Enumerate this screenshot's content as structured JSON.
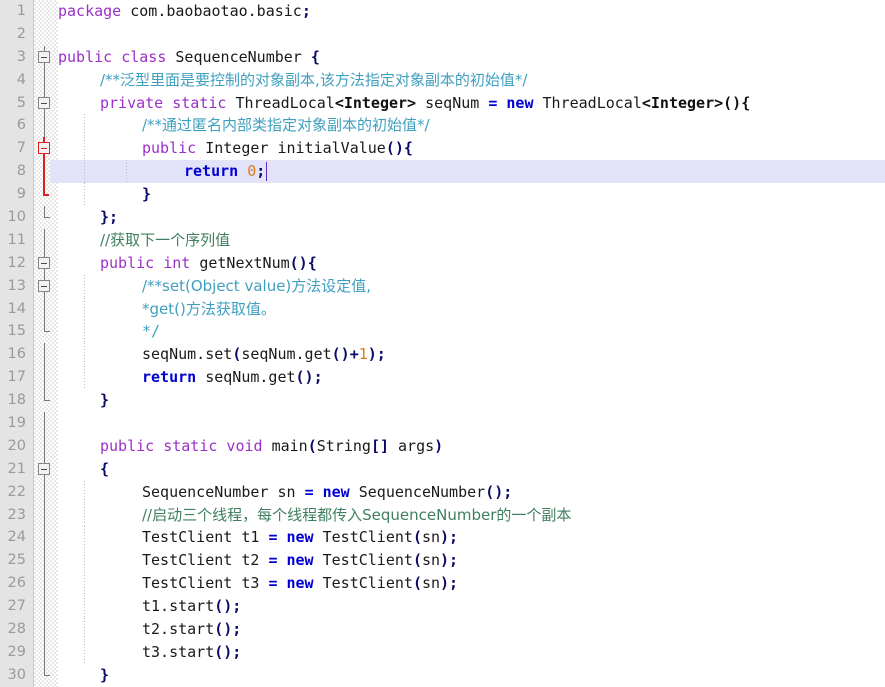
{
  "app": {
    "kind": "code-editor",
    "language": "Java",
    "file_name": "SequenceNumber.java",
    "theme": "light",
    "colors": {
      "background": "#ffffff",
      "gutter_background": "#e4e4e4",
      "line_number": "#9a9a9a",
      "current_line_highlight": "#e2e2f8",
      "keyword": "#9b30c8",
      "keyword_bold": "#0000d4",
      "line_comment": "#3f7f5f",
      "javadoc_comment": "#3f9fbf",
      "number_literal": "#e07b1a",
      "punctuation": "#0a0a66",
      "fold_marker": "#858585",
      "fold_marker_active": "#dd2222",
      "caret": "#5b2bc8"
    }
  },
  "editor": {
    "first_visible_line": 1,
    "last_visible_line": 30,
    "highlighted_line": 8,
    "caret_line": 8,
    "caret_column": 22,
    "total_visible_lines": 30
  },
  "lines": [
    {
      "n": "1",
      "indent": 0,
      "fold": "none",
      "guides": [],
      "tokens": [
        {
          "t": "package ",
          "c": "kw"
        },
        {
          "t": "com.baobaotao.basic",
          "c": "plain"
        },
        {
          "t": ";",
          "c": "punct"
        }
      ]
    },
    {
      "n": "2",
      "indent": 0,
      "fold": "none",
      "guides": [],
      "tokens": []
    },
    {
      "n": "3",
      "indent": 0,
      "fold": "open",
      "guides": [],
      "tokens": [
        {
          "t": "public class ",
          "c": "kw"
        },
        {
          "t": "SequenceNumber ",
          "c": "plain"
        },
        {
          "t": "{",
          "c": "punct"
        }
      ]
    },
    {
      "n": "4",
      "indent": 1,
      "fold": "spine",
      "guides": [],
      "tokens": [
        {
          "t": "/**泛型里面是要控制的对象副本,该方法指定对象副本的初始值*/",
          "c": "doc"
        }
      ]
    },
    {
      "n": "5",
      "indent": 1,
      "fold": "open",
      "guides": [],
      "tokens": [
        {
          "t": "private static ",
          "c": "kw"
        },
        {
          "t": "ThreadLocal",
          "c": "plain"
        },
        {
          "t": "<Integer>",
          "c": "gen"
        },
        {
          "t": " seqNum ",
          "c": "plain"
        },
        {
          "t": "= new ",
          "c": "kw2"
        },
        {
          "t": "ThreadLocal",
          "c": "plain"
        },
        {
          "t": "<Integer>(){",
          "c": "gen"
        }
      ]
    },
    {
      "n": "6",
      "indent": 2,
      "fold": "spine",
      "guides": [
        1
      ],
      "tokens": [
        {
          "t": "/**通过匿名内部类指定对象副本的初始值*/",
          "c": "doc"
        }
      ]
    },
    {
      "n": "7",
      "indent": 2,
      "fold": "open-red",
      "guides": [
        1
      ],
      "tokens": [
        {
          "t": "public ",
          "c": "kw"
        },
        {
          "t": "Integer initialValue",
          "c": "plain"
        },
        {
          "t": "(){",
          "c": "punct"
        }
      ]
    },
    {
      "n": "8",
      "indent": 3,
      "fold": "spine-red",
      "guides": [
        1,
        2
      ],
      "highlight": true,
      "caret": true,
      "tokens": [
        {
          "t": "return ",
          "c": "kw2"
        },
        {
          "t": "0",
          "c": "num"
        },
        {
          "t": ";",
          "c": "punct"
        }
      ]
    },
    {
      "n": "9",
      "indent": 2,
      "fold": "end-red",
      "guides": [
        1
      ],
      "tokens": [
        {
          "t": "}",
          "c": "punct"
        }
      ]
    },
    {
      "n": "10",
      "indent": 1,
      "fold": "end",
      "guides": [],
      "tokens": [
        {
          "t": "};",
          "c": "punct"
        }
      ]
    },
    {
      "n": "11",
      "indent": 1,
      "fold": "spine",
      "guides": [],
      "tokens": [
        {
          "t": "//获取下一个序列值",
          "c": "cmt"
        }
      ]
    },
    {
      "n": "12",
      "indent": 1,
      "fold": "open",
      "guides": [],
      "tokens": [
        {
          "t": "public int ",
          "c": "kw"
        },
        {
          "t": "getNextNum",
          "c": "plain"
        },
        {
          "t": "(){",
          "c": "punct"
        }
      ]
    },
    {
      "n": "13",
      "indent": 2,
      "fold": "open",
      "guides": [
        1
      ],
      "tokens": [
        {
          "t": "/**set(Object value)方法设定值,",
          "c": "doc"
        }
      ]
    },
    {
      "n": "14",
      "indent": 2,
      "fold": "spine",
      "guides": [
        1
      ],
      "tokens": [
        {
          "t": "*get()方法获取值。",
          "c": "doc"
        }
      ]
    },
    {
      "n": "15",
      "indent": 2,
      "fold": "end",
      "guides": [
        1
      ],
      "tokens": [
        {
          "t": "*/",
          "c": "doc"
        }
      ]
    },
    {
      "n": "16",
      "indent": 2,
      "fold": "spine",
      "guides": [
        1
      ],
      "tokens": [
        {
          "t": "seqNum.set",
          "c": "plain"
        },
        {
          "t": "(",
          "c": "punct"
        },
        {
          "t": "seqNum.get",
          "c": "plain"
        },
        {
          "t": "()+",
          "c": "punct"
        },
        {
          "t": "1",
          "c": "num"
        },
        {
          "t": ");",
          "c": "punct"
        }
      ]
    },
    {
      "n": "17",
      "indent": 2,
      "fold": "spine",
      "guides": [
        1
      ],
      "tokens": [
        {
          "t": "return ",
          "c": "kw2"
        },
        {
          "t": "seqNum.get",
          "c": "plain"
        },
        {
          "t": "();",
          "c": "punct"
        }
      ]
    },
    {
      "n": "18",
      "indent": 1,
      "fold": "end",
      "guides": [],
      "tokens": [
        {
          "t": "}",
          "c": "punct"
        }
      ]
    },
    {
      "n": "19",
      "indent": 0,
      "fold": "spine",
      "guides": [],
      "tokens": []
    },
    {
      "n": "20",
      "indent": 1,
      "fold": "spine",
      "guides": [],
      "tokens": [
        {
          "t": "public static void ",
          "c": "kw"
        },
        {
          "t": "main",
          "c": "plain"
        },
        {
          "t": "(",
          "c": "punct"
        },
        {
          "t": "String",
          "c": "plain"
        },
        {
          "t": "[]",
          "c": "punct"
        },
        {
          "t": " args",
          "c": "plain"
        },
        {
          "t": ")",
          "c": "punct"
        }
      ]
    },
    {
      "n": "21",
      "indent": 1,
      "fold": "open",
      "guides": [],
      "tokens": [
        {
          "t": "{",
          "c": "punct"
        }
      ]
    },
    {
      "n": "22",
      "indent": 2,
      "fold": "spine",
      "guides": [
        1
      ],
      "tokens": [
        {
          "t": "SequenceNumber sn ",
          "c": "plain"
        },
        {
          "t": "= new ",
          "c": "kw2"
        },
        {
          "t": "SequenceNumber",
          "c": "plain"
        },
        {
          "t": "();",
          "c": "punct"
        }
      ]
    },
    {
      "n": "23",
      "indent": 2,
      "fold": "spine",
      "guides": [
        1
      ],
      "tokens": [
        {
          "t": "//启动三个线程，每个线程都传入SequenceNumber的一个副本",
          "c": "cmt"
        }
      ]
    },
    {
      "n": "24",
      "indent": 2,
      "fold": "spine",
      "guides": [
        1
      ],
      "tokens": [
        {
          "t": "TestClient t1 ",
          "c": "plain"
        },
        {
          "t": "= new ",
          "c": "kw2"
        },
        {
          "t": "TestClient",
          "c": "plain"
        },
        {
          "t": "(",
          "c": "punct"
        },
        {
          "t": "sn",
          "c": "plain"
        },
        {
          "t": ");",
          "c": "punct"
        }
      ]
    },
    {
      "n": "25",
      "indent": 2,
      "fold": "spine",
      "guides": [
        1
      ],
      "tokens": [
        {
          "t": "TestClient t2 ",
          "c": "plain"
        },
        {
          "t": "= new ",
          "c": "kw2"
        },
        {
          "t": "TestClient",
          "c": "plain"
        },
        {
          "t": "(",
          "c": "punct"
        },
        {
          "t": "sn",
          "c": "plain"
        },
        {
          "t": ");",
          "c": "punct"
        }
      ]
    },
    {
      "n": "26",
      "indent": 2,
      "fold": "spine",
      "guides": [
        1
      ],
      "tokens": [
        {
          "t": "TestClient t3 ",
          "c": "plain"
        },
        {
          "t": "= new ",
          "c": "kw2"
        },
        {
          "t": "TestClient",
          "c": "plain"
        },
        {
          "t": "(",
          "c": "punct"
        },
        {
          "t": "sn",
          "c": "plain"
        },
        {
          "t": ");",
          "c": "punct"
        }
      ]
    },
    {
      "n": "27",
      "indent": 2,
      "fold": "spine",
      "guides": [
        1
      ],
      "tokens": [
        {
          "t": "t1.start",
          "c": "plain"
        },
        {
          "t": "();",
          "c": "punct"
        }
      ]
    },
    {
      "n": "28",
      "indent": 2,
      "fold": "spine",
      "guides": [
        1
      ],
      "tokens": [
        {
          "t": "t2.start",
          "c": "plain"
        },
        {
          "t": "();",
          "c": "punct"
        }
      ]
    },
    {
      "n": "29",
      "indent": 2,
      "fold": "spine",
      "guides": [
        1
      ],
      "tokens": [
        {
          "t": "t3.start",
          "c": "plain"
        },
        {
          "t": "();",
          "c": "punct"
        }
      ]
    },
    {
      "n": "30",
      "indent": 1,
      "fold": "end",
      "guides": [],
      "tokens": [
        {
          "t": "}",
          "c": "punct"
        }
      ]
    }
  ]
}
